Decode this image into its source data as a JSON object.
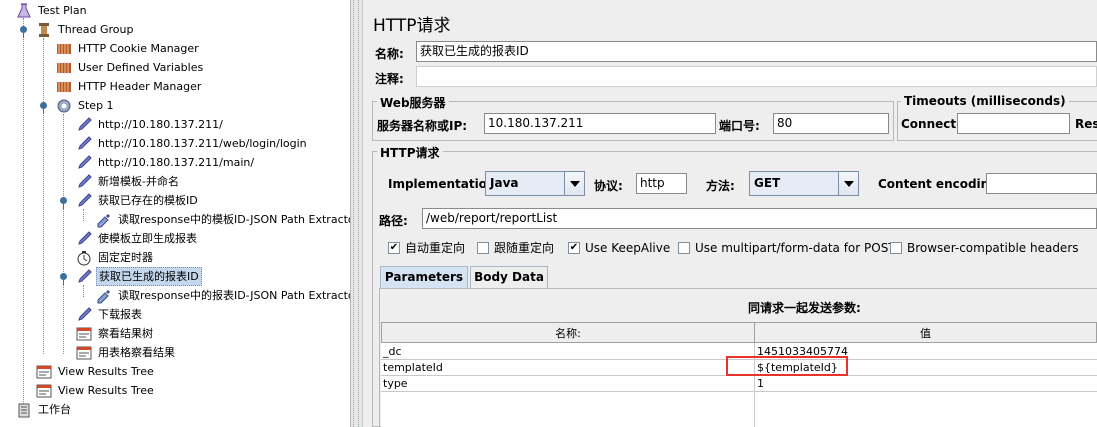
{
  "tree": {
    "items": [
      {
        "label": "Test Plan",
        "icon": "flask-icon"
      },
      {
        "label": "Thread Group",
        "icon": "spool-icon"
      },
      {
        "label": "HTTP Cookie Manager",
        "icon": "config-element-icon"
      },
      {
        "label": "User Defined Variables",
        "icon": "config-element-icon"
      },
      {
        "label": "HTTP Header Manager",
        "icon": "config-element-icon"
      },
      {
        "label": "Step 1",
        "icon": "gear-controller-icon"
      },
      {
        "label": "http://10.180.137.211/",
        "icon": "pipette-sampler-icon"
      },
      {
        "label": "http://10.180.137.211/web/login/login",
        "icon": "pipette-sampler-icon"
      },
      {
        "label": "http://10.180.137.211/main/",
        "icon": "pipette-sampler-icon"
      },
      {
        "label": "新增模板-并命名",
        "icon": "pipette-sampler-icon"
      },
      {
        "label": "获取已存在的模板ID",
        "icon": "pipette-sampler-icon"
      },
      {
        "label": "读取response中的模板ID-JSON Path Extractor",
        "icon": "extractor-icon"
      },
      {
        "label": "使模板立即生成报表",
        "icon": "pipette-sampler-icon"
      },
      {
        "label": "固定定时器",
        "icon": "timer-icon"
      },
      {
        "label": "获取已生成的报表ID",
        "icon": "pipette-sampler-icon"
      },
      {
        "label": "读取response中的报表ID-JSON Path Extractor",
        "icon": "extractor-icon"
      },
      {
        "label": "下载报表",
        "icon": "pipette-sampler-icon"
      },
      {
        "label": "察看结果树",
        "icon": "listener-icon"
      },
      {
        "label": "用表格察看结果",
        "icon": "listener-icon"
      },
      {
        "label": "View Results Tree",
        "icon": "listener-icon"
      },
      {
        "label": "View Results Tree",
        "icon": "listener-icon"
      },
      {
        "label": "工作台",
        "icon": "workbench-icon"
      }
    ]
  },
  "panel": {
    "title": "HTTP请求",
    "name_label": "名称:",
    "name_value": "获取已生成的报表ID",
    "comment_label": "注释:",
    "comment_value": "",
    "web_server": {
      "title": "Web服务器",
      "server_label": "服务器名称或IP:",
      "server_value": "10.180.137.211",
      "port_label": "端口号:",
      "port_value": "80"
    },
    "timeouts": {
      "title": "Timeouts (milliseconds)",
      "connect_label": "Connect:",
      "connect_value": "",
      "response_label": "Res"
    },
    "http_request": {
      "title": "HTTP请求",
      "implementation_label": "Implementation:",
      "implementation_value": "Java",
      "protocol_label": "协议:",
      "protocol_value": "http",
      "method_label": "方法:",
      "method_value": "GET",
      "encoding_label": "Content encoding:",
      "encoding_value": "",
      "path_label": "路径:",
      "path_value": "/web/report/reportList"
    },
    "checkboxes": [
      {
        "label": "自动重定向",
        "checked": true
      },
      {
        "label": "跟随重定向",
        "checked": false
      },
      {
        "label": "Use KeepAlive",
        "checked": true
      },
      {
        "label": "Use multipart/form-data for POST",
        "checked": false
      },
      {
        "label": "Browser-compatible headers",
        "checked": false
      }
    ],
    "tabs": [
      {
        "label": "Parameters",
        "active": true
      },
      {
        "label": "Body Data",
        "active": false
      }
    ],
    "params": {
      "caption": "同请求一起发送参数:",
      "col_name": "名称:",
      "col_value": "值",
      "rows": [
        {
          "name": "_dc",
          "value": "1451033405774"
        },
        {
          "name": "templateId",
          "value": "${templateId}"
        },
        {
          "name": "type",
          "value": "1"
        }
      ],
      "highlight_color": "#e8322b"
    }
  }
}
